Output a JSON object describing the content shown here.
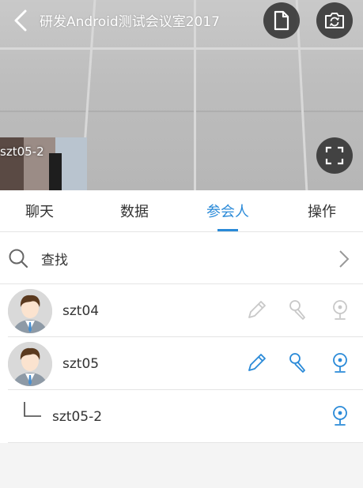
{
  "header": {
    "title": "研发Android测试会议室2017"
  },
  "video": {
    "thumbnail_label": "szt05-2"
  },
  "tabs": [
    {
      "label": "聊天",
      "active": false
    },
    {
      "label": "数据",
      "active": false
    },
    {
      "label": "参会人",
      "active": true
    },
    {
      "label": "操作",
      "active": false
    }
  ],
  "search": {
    "label": "查找"
  },
  "participants": [
    {
      "name": "szt04",
      "avatar": "male-avatar",
      "controls_enabled": false
    },
    {
      "name": "szt05",
      "avatar": "male-avatar",
      "controls_enabled": true
    },
    {
      "name": "szt05-2",
      "sub_device": true
    }
  ],
  "colors": {
    "accent": "#2a8ad8",
    "disabled": "#c8c8c8",
    "video_bg": "#bdbdbd"
  },
  "icons": [
    "back-arrow-icon",
    "document-icon",
    "switch-camera-icon",
    "fullscreen-icon",
    "search-icon",
    "chevron-right-icon",
    "pencil-icon",
    "microphone-icon",
    "webcam-icon",
    "tree-branch-icon"
  ]
}
